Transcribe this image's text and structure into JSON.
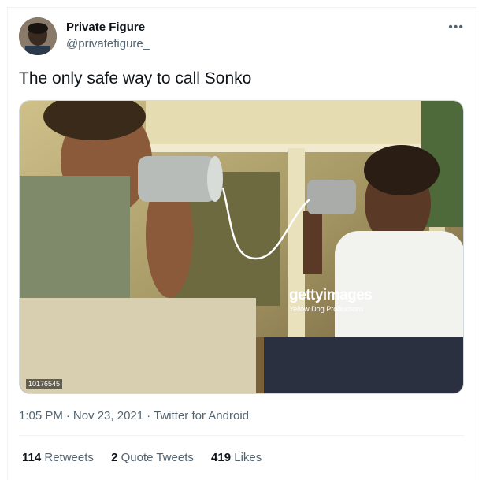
{
  "author": {
    "name": "Private Figure",
    "handle": "@privatefigure_"
  },
  "tweet": {
    "text": "The only safe way to call Sonko",
    "time": "1:05 PM",
    "date": "Nov 23, 2021",
    "source": "Twitter for Android"
  },
  "media": {
    "watermark_logo": "gettyimages",
    "watermark_sub": "Yellow Dog Productions",
    "image_id": "10176545"
  },
  "stats": {
    "retweets_count": "114",
    "retweets_label": "Retweets",
    "quotes_count": "2",
    "quotes_label": "Quote Tweets",
    "likes_count": "419",
    "likes_label": "Likes"
  },
  "icons": {
    "more": "more-horizontal-icon"
  },
  "separator": "·"
}
